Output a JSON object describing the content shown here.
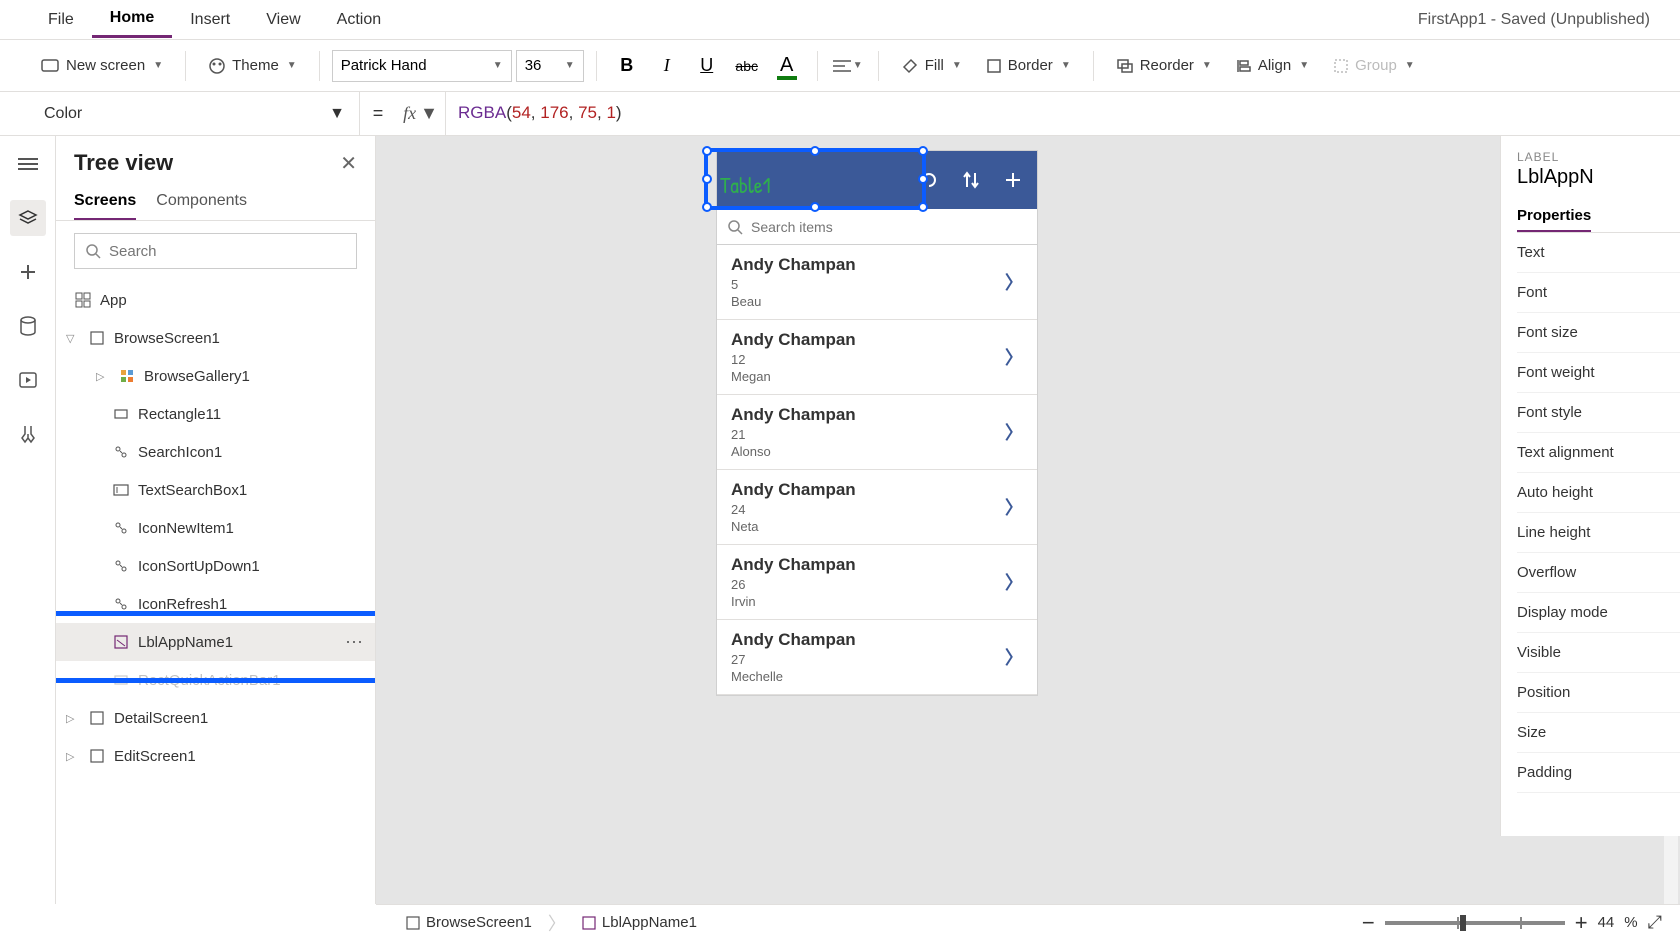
{
  "menubar": {
    "items": [
      "File",
      "Home",
      "Insert",
      "View",
      "Action"
    ],
    "active_index": 1,
    "app_title": "FirstApp1 - Saved (Unpublished)"
  },
  "ribbon": {
    "new_screen": "New screen",
    "theme": "Theme",
    "font_family": "Patrick Hand",
    "font_size": "36",
    "fill": "Fill",
    "border": "Border",
    "reorder": "Reorder",
    "align": "Align",
    "group": "Group"
  },
  "formula": {
    "property": "Color",
    "fn": "RGBA",
    "args": [
      "54",
      "176",
      "75",
      "1"
    ]
  },
  "tree": {
    "title": "Tree view",
    "tabs": [
      "Screens",
      "Components"
    ],
    "active_tab": 0,
    "search_placeholder": "Search",
    "app_label": "App",
    "nodes": {
      "browse_screen": "BrowseScreen1",
      "browse_gallery": "BrowseGallery1",
      "rectangle": "Rectangle11",
      "search_icon": "SearchIcon1",
      "text_search": "TextSearchBox1",
      "icon_new": "IconNewItem1",
      "icon_sort": "IconSortUpDown1",
      "icon_refresh": "IconRefresh1",
      "lbl_app_name": "LblAppName1",
      "rect_quick": "RectQuickActionBar1",
      "detail_screen": "DetailScreen1",
      "edit_screen": "EditScreen1"
    }
  },
  "canvas": {
    "selected_label_text": "Table1",
    "search_placeholder": "Search items",
    "rows": [
      {
        "name": "Andy Champan",
        "num": "5",
        "sub": "Beau"
      },
      {
        "name": "Andy Champan",
        "num": "12",
        "sub": "Megan"
      },
      {
        "name": "Andy Champan",
        "num": "21",
        "sub": "Alonso"
      },
      {
        "name": "Andy Champan",
        "num": "24",
        "sub": "Neta"
      },
      {
        "name": "Andy Champan",
        "num": "26",
        "sub": "Irvin"
      },
      {
        "name": "Andy Champan",
        "num": "27",
        "sub": "Mechelle"
      }
    ]
  },
  "props": {
    "caption": "LABEL",
    "control_name": "LblAppN",
    "tab": "Properties",
    "rows": [
      "Text",
      "Font",
      "Font size",
      "Font weight",
      "Font style",
      "Text alignment",
      "Auto height",
      "Line height",
      "Overflow",
      "Display mode",
      "Visible",
      "Position",
      "Size",
      "Padding"
    ]
  },
  "status": {
    "crumb1": "BrowseScreen1",
    "crumb2": "LblAppName1",
    "zoom_pct": "44",
    "pct_sign": "%"
  }
}
